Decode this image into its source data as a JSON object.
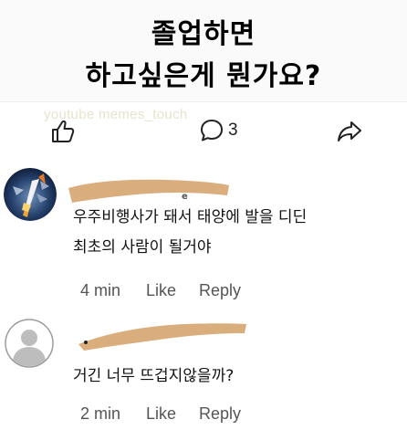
{
  "title": {
    "line1": "졸업하면",
    "line2": "하고싶은게 뭔가요?"
  },
  "watermark": "youtube memes_touch",
  "action_bar": {
    "like_icon": "thumbs-up-icon",
    "comment_icon": "speech-bubble-icon",
    "comment_count": "3",
    "share_icon": "share-arrow-icon"
  },
  "comments": [
    {
      "avatar": "rocket-avatar",
      "name_tail": "e",
      "lines": [
        "우주비행사가 돼서 태양에 발을 디딘",
        "최초의 사람이 될거야"
      ],
      "time": "4 min",
      "like_label": "Like",
      "reply_label": "Reply"
    },
    {
      "avatar": "default-user-avatar",
      "lines": [
        "거긴 너무 뜨겁지않을까?"
      ],
      "time": "2 min",
      "like_label": "Like",
      "reply_label": "Reply"
    }
  ],
  "colors": {
    "redaction": "#d9ad7c",
    "title_band": "#fafafa",
    "watermark": "#e8e3cc",
    "meta_text": "#555555"
  }
}
